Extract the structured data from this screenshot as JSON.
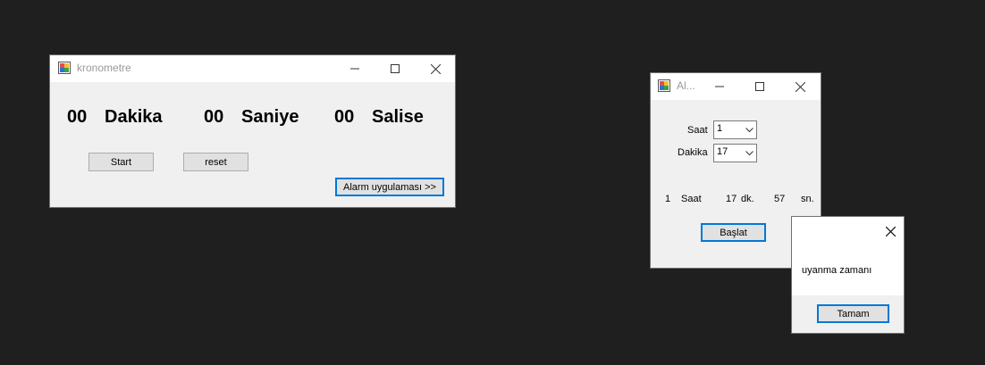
{
  "kronometre": {
    "title": "kronometre",
    "minutes_value": "00",
    "minutes_label": "Dakika",
    "seconds_value": "00",
    "seconds_label": "Saniye",
    "ms_value": "00",
    "ms_label": "Salise",
    "start_button": "Start",
    "reset_button": "reset",
    "alarm_button": "Alarm uygulaması >>"
  },
  "alarm": {
    "title": "Al...",
    "hour_label": "Saat",
    "hour_value": "1",
    "minute_label": "Dakika",
    "minute_value": "17",
    "remaining": {
      "hours": "1",
      "hours_unit": "Saat",
      "minutes": "17",
      "minutes_unit": "dk.",
      "seconds": "57",
      "seconds_unit": "sn."
    },
    "start_button": "Başlat"
  },
  "message_box": {
    "text": "uyanma zamanı",
    "ok_button": "Tamam"
  },
  "icons": {
    "app_icon": "windows-form-icon",
    "minimize": "minimize-icon",
    "maximize": "maximize-icon",
    "close": "close-icon"
  }
}
